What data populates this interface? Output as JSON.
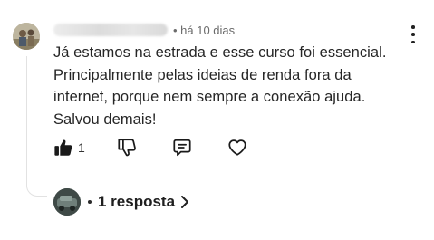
{
  "comment": {
    "meta": "• há 10 dias",
    "text": "Já estamos na estrada e esse curso foi essencial. Principalmente pelas ideias de renda fora da internet, porque nem sempre a conexão ajuda. Salvou demais!",
    "like_count": "1"
  },
  "replies": {
    "label": "1 resposta"
  },
  "icons": {
    "avatar": "avatar-icon",
    "more": "more-vertical-icon",
    "like": "thumbs-up-filled-icon",
    "dislike": "thumbs-down-icon",
    "reply": "comment-icon",
    "heart": "heart-icon",
    "chevron": "chevron-right-icon"
  }
}
